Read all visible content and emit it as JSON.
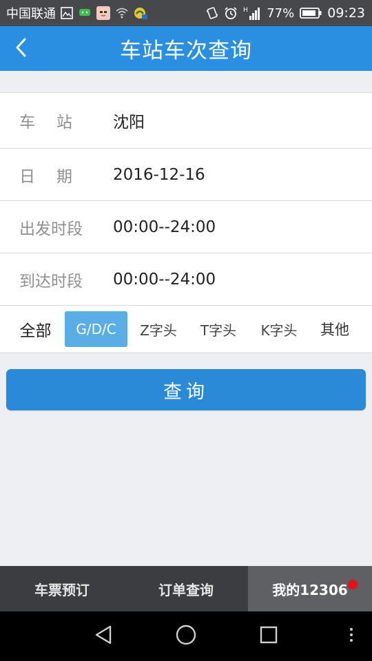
{
  "status_bar": {
    "carrier": "中国联通",
    "battery": "77%",
    "time": "09:23",
    "icons": [
      "image-icon",
      "chat-icon",
      "avatar-app-icon",
      "wifi-icon",
      "app-notification-icon",
      "vibrate-icon",
      "alarm-icon",
      "signal-icon",
      "battery-icon"
    ]
  },
  "header": {
    "title": "车站车次查询",
    "back_icon": "chevron-left-icon"
  },
  "form": {
    "station_label": "车站",
    "station_value": "沈阳",
    "date_label": "日期",
    "date_value": "2016-12-16",
    "depart_label": "出发时段",
    "depart_value": "00:00--24:00",
    "arrive_label": "到达时段",
    "arrive_value": "00:00--24:00"
  },
  "filters": {
    "all_label": "全部",
    "options": [
      "G/D/C",
      "Z字头",
      "T字头",
      "K字头",
      "其他"
    ],
    "selected": "G/D/C"
  },
  "query_button": "查询",
  "tabs": {
    "items": [
      "车票预订",
      "订单查询",
      "我的12306"
    ],
    "active": "我的12306",
    "badge_color": "#e8101b"
  },
  "colors": {
    "accent": "#2a8ee1",
    "chip_active": "#5aaee5",
    "background": "#eeeff3"
  }
}
